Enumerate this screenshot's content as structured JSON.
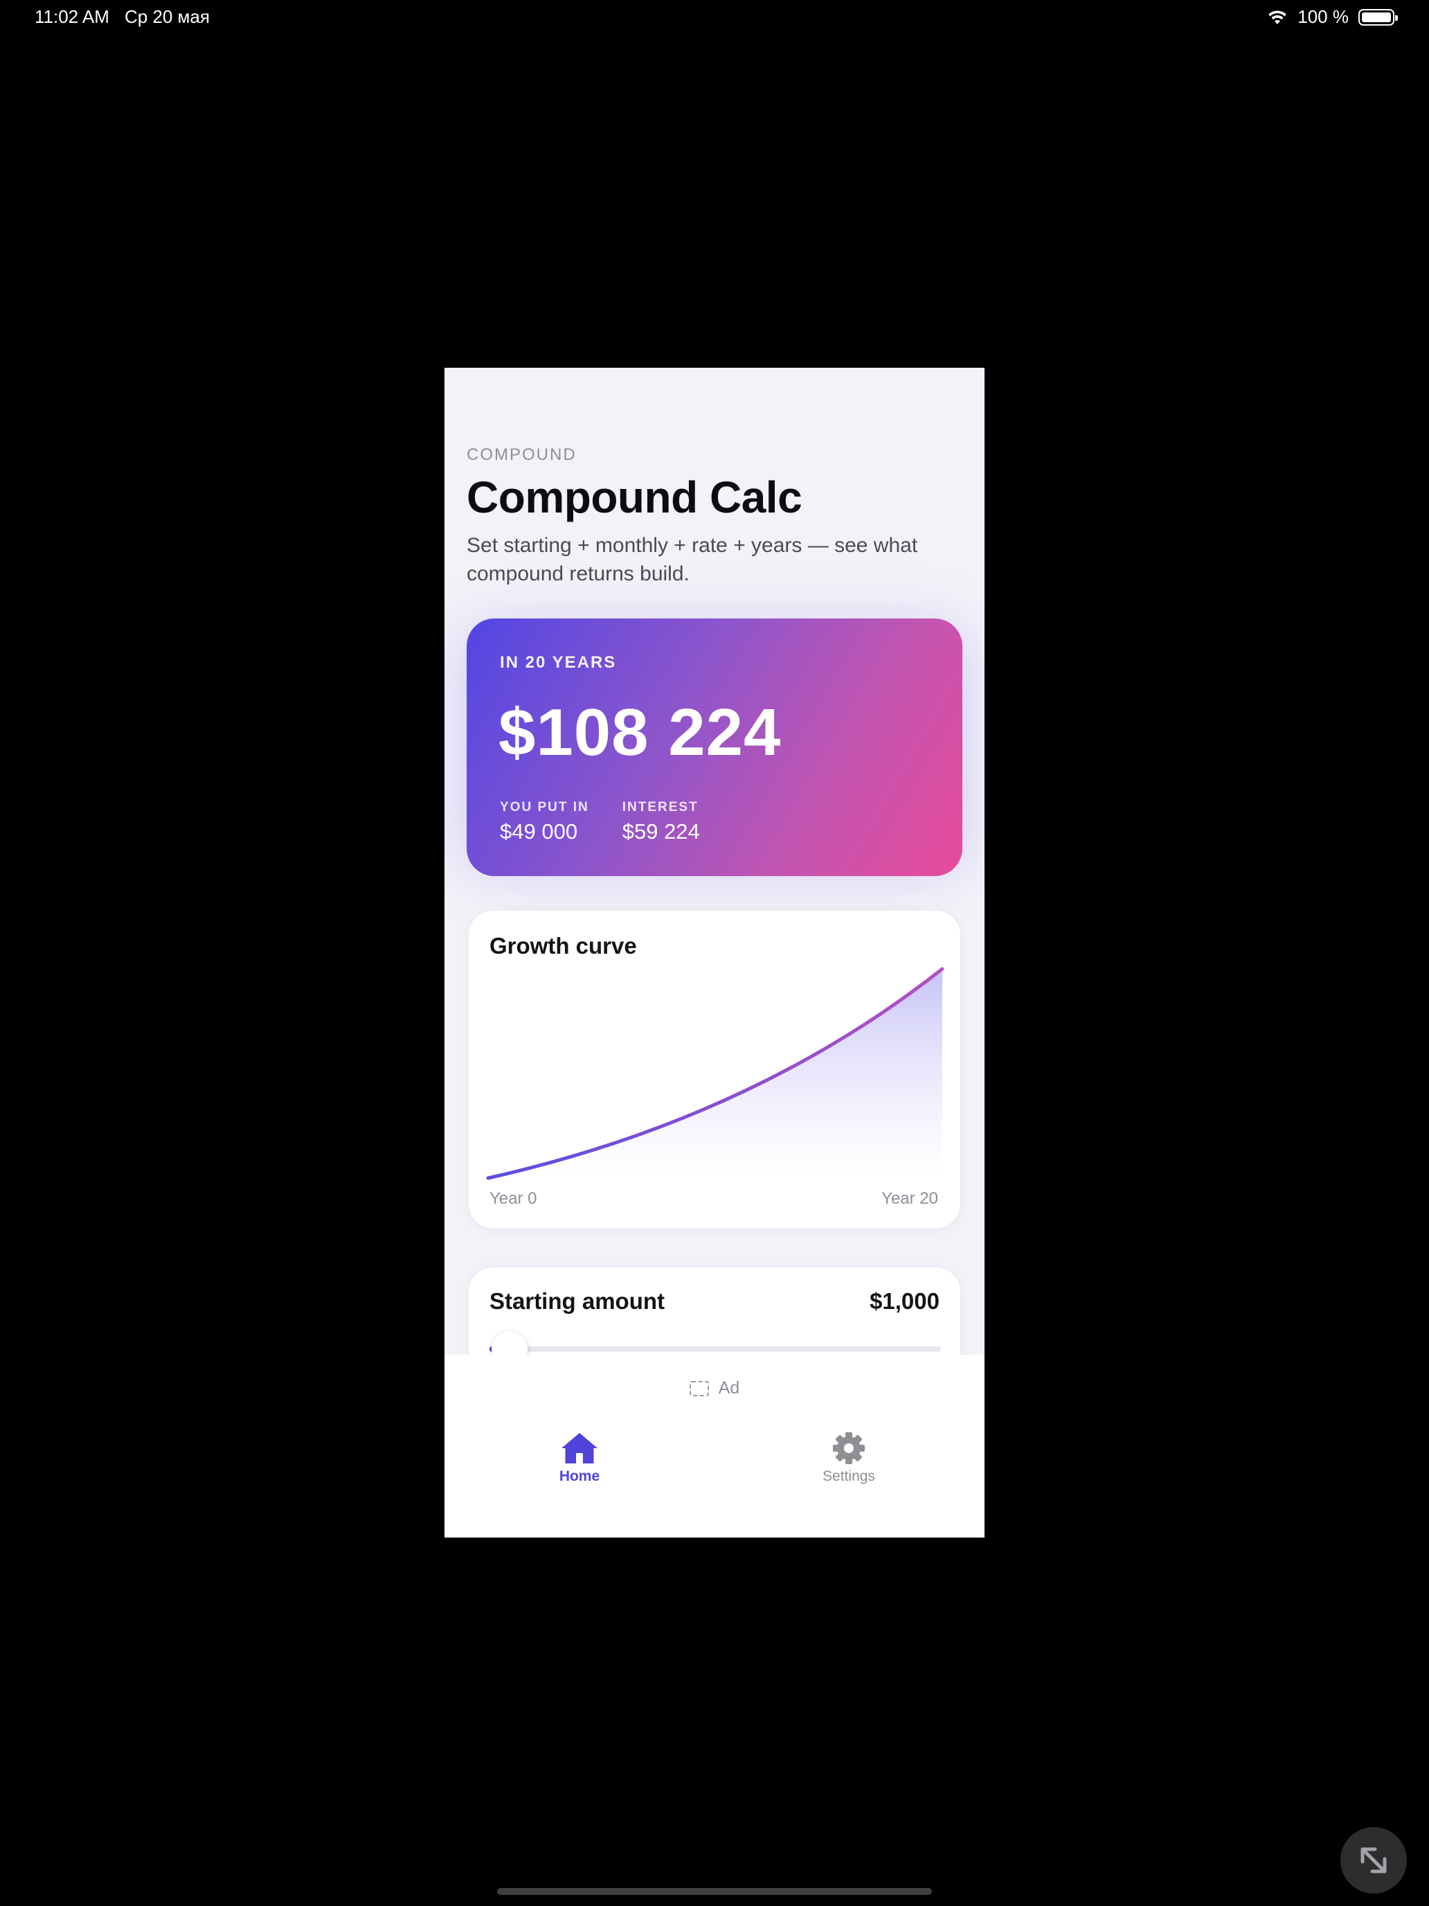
{
  "status_bar": {
    "time": "11:02 AM",
    "date": "Ср 20 мая",
    "battery": "100 %",
    "icons": [
      "wifi-icon",
      "battery-icon"
    ]
  },
  "header": {
    "eyebrow": "COMPOUND",
    "title": "Compound Calc",
    "subtitle": "Set starting + monthly + rate + years — see what compound returns build."
  },
  "hero": {
    "label": "IN 20 YEARS",
    "total": "$108 224",
    "put_in_label": "YOU PUT IN",
    "put_in_value": "$49 000",
    "interest_label": "INTEREST",
    "interest_value": "$59 224",
    "gradient": [
      "#5246e3",
      "#e84a9b"
    ]
  },
  "growth_chart": {
    "title": "Growth curve",
    "x_start_label": "Year 0",
    "x_end_label": "Year 20",
    "line_colors": [
      "#5a4ee0",
      "#b54fc4"
    ]
  },
  "starting_amount": {
    "label": "Starting amount",
    "value": "$1,000",
    "slider_fraction": 0.01
  },
  "ad": {
    "label": "Ad"
  },
  "tabs": [
    {
      "label": "Home",
      "icon": "house-icon",
      "active": true
    },
    {
      "label": "Settings",
      "icon": "gear-icon",
      "active": false
    }
  ],
  "colors": {
    "accent": "#4f43d9",
    "background": "#f3f2f8"
  }
}
